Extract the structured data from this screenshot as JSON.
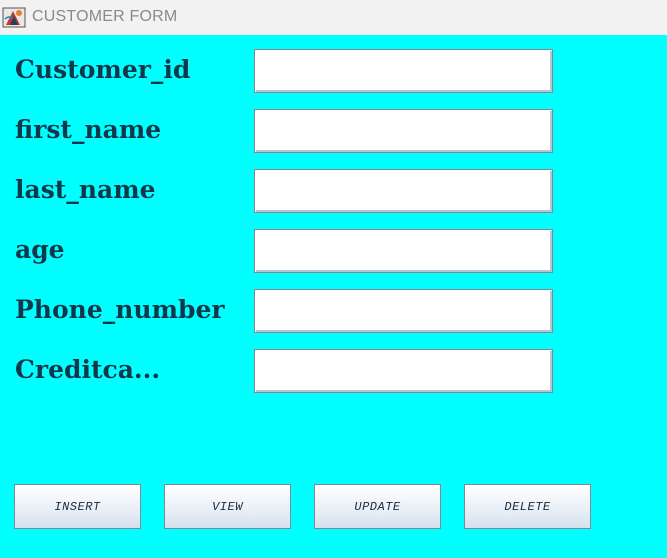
{
  "window": {
    "title": "CUSTOMER FORM",
    "icon": "java-app-icon"
  },
  "form": {
    "fields": [
      {
        "label": "Customer_id",
        "value": ""
      },
      {
        "label": "first_name",
        "value": ""
      },
      {
        "label": "last_name",
        "value": ""
      },
      {
        "label": "age",
        "value": ""
      },
      {
        "label": "Phone_number",
        "value": ""
      },
      {
        "label": "Creditca...",
        "value": ""
      }
    ]
  },
  "buttons": {
    "insert": "INSERT",
    "view": "VIEW",
    "update": "UPDATE",
    "delete": "DELETE"
  },
  "colors": {
    "background": "#00ffff",
    "label": "#12364a",
    "titlebar": "#f2f2f2"
  }
}
